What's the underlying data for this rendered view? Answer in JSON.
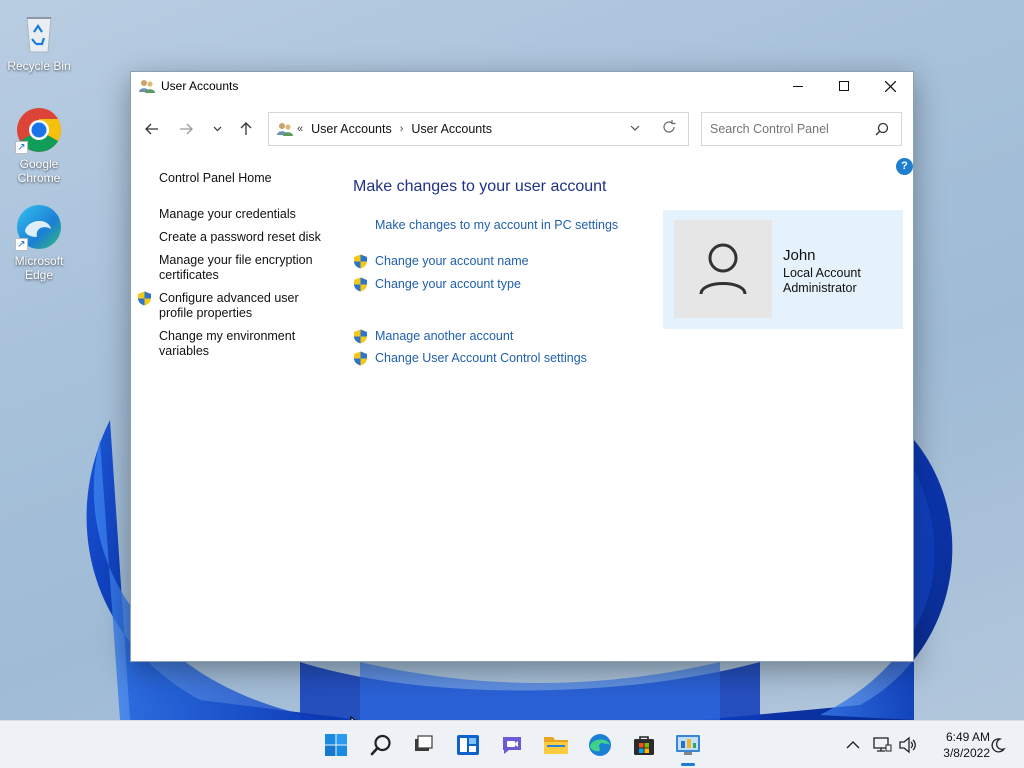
{
  "desktop": {
    "icons": [
      {
        "label": "Recycle Bin"
      },
      {
        "label": "Google Chrome"
      },
      {
        "label": "Microsoft Edge"
      }
    ]
  },
  "window": {
    "title": "User Accounts",
    "controls": {
      "minimize": "—",
      "maximize": "☐",
      "close": "✕"
    }
  },
  "address_bar": {
    "overflow": "«",
    "crumbs": [
      "User Accounts",
      "User Accounts"
    ],
    "separator": "›"
  },
  "search": {
    "placeholder": "Search Control Panel"
  },
  "left_pane": {
    "home": "Control Panel Home",
    "items": [
      {
        "label": "Manage your credentials",
        "shield": false
      },
      {
        "label": "Create a password reset disk",
        "shield": false
      },
      {
        "label": "Manage your file encryption certificates",
        "shield": false
      },
      {
        "label": "Configure advanced user profile properties",
        "shield": true
      },
      {
        "label": "Change my environment variables",
        "shield": false
      }
    ]
  },
  "main": {
    "heading": "Make changes to your user account",
    "links": [
      {
        "label": "Make changes to my account in PC settings",
        "shield": false
      },
      {
        "label": "Change your account name",
        "shield": true
      },
      {
        "label": "Change your account type",
        "shield": true
      },
      {
        "label": "Manage another account",
        "shield": true
      },
      {
        "label": "Change User Account Control settings",
        "shield": true
      }
    ]
  },
  "account": {
    "name": "John",
    "type_line1": "Local Account",
    "type_line2": "Administrator"
  },
  "help": {
    "label": "?"
  },
  "taskbar": {
    "apps": [
      "start",
      "search",
      "task-view",
      "widgets",
      "chat",
      "file-explorer",
      "edge",
      "store",
      "control-panel"
    ],
    "active_app": "control-panel",
    "time": "6:49 AM",
    "date": "3/8/2022"
  },
  "colors": {
    "link": "#1f5fae",
    "heading": "#1e3287",
    "tile": "#e5f1fb",
    "accent": "#1f7ad8"
  }
}
